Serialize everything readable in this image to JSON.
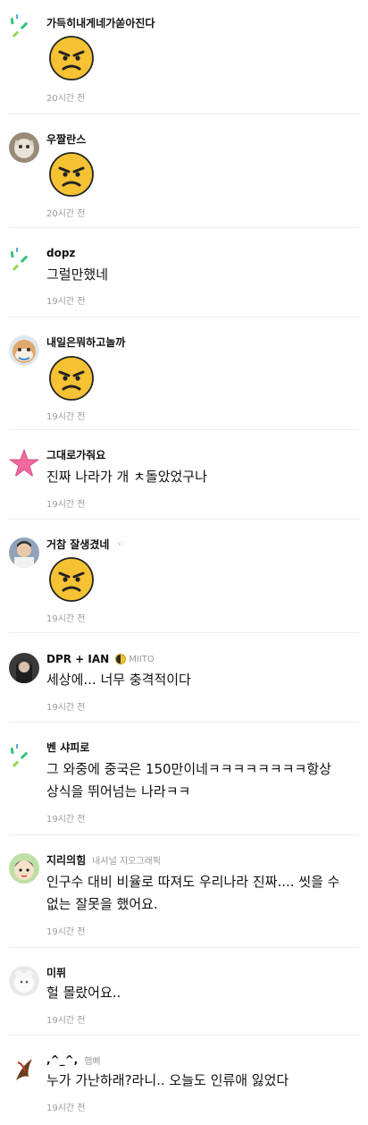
{
  "comments": [
    {
      "nickname": "가득히내게네가쏟아진다",
      "badge": "",
      "text": "",
      "time": "20시간 전"
    },
    {
      "nickname": "우짤란스",
      "badge": "",
      "text": "",
      "time": "20시간 전"
    },
    {
      "nickname": "dopz",
      "badge": "",
      "text": "그럴만했네",
      "time": "19시간 전"
    },
    {
      "nickname": "내일은뭐하고놀까",
      "badge": "",
      "text": "",
      "time": "19시간 전"
    },
    {
      "nickname": "그대로가줘요",
      "badge": "",
      "text": "진짜 나라가 개 ㅊ돌았었구나",
      "time": "19시간 전"
    },
    {
      "nickname": "거참 잘생겼네",
      "badge": "",
      "text": "",
      "time": "19시간 전"
    },
    {
      "nickname": "DPR + IAN",
      "badge": "MIITO",
      "text": "세상에... 너무 충격적이다",
      "time": "19시간 전"
    },
    {
      "nickname": "벤 샤피로",
      "badge": "",
      "text_line1": "그 와중에 중국은 150만이네ㅋㅋㅋㅋㅋㅋㅋㅋ항상",
      "text_line2": "상식을 뛰어넘는 나라ㅋㅋ",
      "time": "19시간 전"
    },
    {
      "nickname": "지리의힘",
      "badge": "내셔널 지오그래픽",
      "text_line1": "인구수 대비 비율로 따져도 우리나라 진짜.... 씻을 수",
      "text_line2": "없는 잘못을 했어요.",
      "time": "19시간 전"
    },
    {
      "nickname": "미퓌",
      "badge": "",
      "text": "헐 몰랐어요..",
      "time": "19시간 전"
    },
    {
      "nickname": ",^_^,",
      "badge": "햅삐",
      "text": "누가 가난하래?라니.. 오늘도 인류애 잃었다",
      "time": "19시간 전"
    }
  ],
  "icons": {
    "angry": "angry-face-emoji",
    "default_avatar": "sparkle-lines-avatar",
    "pin": "hand-pointer-icon"
  },
  "colors": {
    "emoji_yellow": "#f5c233",
    "time_gray": "#9a9a9a",
    "separator": "#ececec"
  }
}
